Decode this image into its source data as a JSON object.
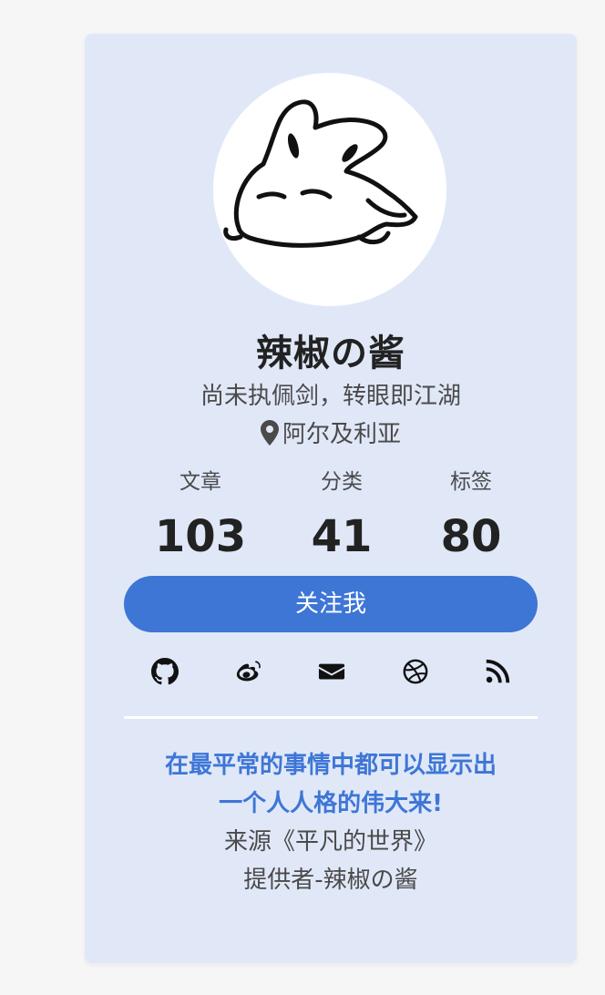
{
  "profile": {
    "name": "辣椒の酱",
    "motto": "尚未执佩剑，转眼即江湖",
    "location": "阿尔及利亚"
  },
  "stats": [
    {
      "label": "文章",
      "value": "103"
    },
    {
      "label": "分类",
      "value": "41"
    },
    {
      "label": "标签",
      "value": "80"
    }
  ],
  "follow_button": {
    "label": "关注我"
  },
  "socials": [
    {
      "icon": "github-icon"
    },
    {
      "icon": "weibo-icon"
    },
    {
      "icon": "envelope-icon"
    },
    {
      "icon": "dribbble-icon"
    },
    {
      "icon": "rss-icon"
    }
  ],
  "quote": {
    "line1": "在最平常的事情中都可以显示出",
    "line2": "一个人人格的伟大来!",
    "source": "来源《平凡的世界》",
    "provider": "提供者-辣椒の酱"
  },
  "colors": {
    "card_bg": "#e0e8f8",
    "accent": "#3e76d6",
    "text_dark": "#222222",
    "text_muted": "#4a4a4a"
  }
}
